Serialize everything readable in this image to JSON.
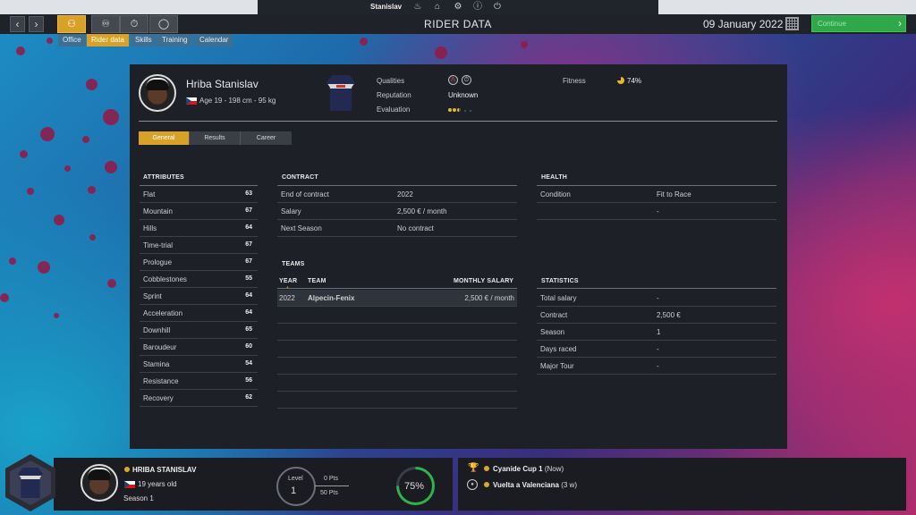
{
  "topbar": {
    "manager_name": "Stanislav"
  },
  "nav": {
    "page_title": "RIDER DATA",
    "date": "09 January 2022",
    "continue_label": "Continue",
    "subtabs": [
      "Office",
      "Rider data",
      "Skills",
      "Training",
      "Calendar"
    ],
    "active_subtab": "Rider data"
  },
  "rider": {
    "name": "Hriba Stanislav",
    "sub": "Age 19 - 198 cm - 95 kg",
    "nationality": "Czech Republic",
    "qualities_label": "Qualities",
    "reputation_label": "Reputation",
    "reputation_value": "Unknown",
    "evaluation_label": "Evaluation",
    "evaluation_stars": 2.5,
    "fitness_label": "Fitness",
    "fitness_value": "74%"
  },
  "profile_tabs": [
    "General",
    "Results",
    "Career"
  ],
  "attributes": {
    "title": "ATTRIBUTES",
    "items": [
      {
        "name": "Flat",
        "value": "63"
      },
      {
        "name": "Mountain",
        "value": "67"
      },
      {
        "name": "Hills",
        "value": "64"
      },
      {
        "name": "Time-trial",
        "value": "67"
      },
      {
        "name": "Prologue",
        "value": "67"
      },
      {
        "name": "Cobblestones",
        "value": "55"
      },
      {
        "name": "Sprint",
        "value": "64"
      },
      {
        "name": "Acceleration",
        "value": "64"
      },
      {
        "name": "Downhill",
        "value": "65"
      },
      {
        "name": "Baroudeur",
        "value": "60"
      },
      {
        "name": "Stamina",
        "value": "54"
      },
      {
        "name": "Resistance",
        "value": "56"
      },
      {
        "name": "Recovery",
        "value": "62"
      }
    ]
  },
  "contract": {
    "title": "CONTRACT",
    "rows": [
      {
        "k": "End of contract",
        "v": "2022"
      },
      {
        "k": "Salary",
        "v": "2,500 € / month"
      },
      {
        "k": "Next Season",
        "v": "No contract"
      }
    ]
  },
  "teams": {
    "title": "TEAMS",
    "headers": {
      "year": "YEAR",
      "team": "TEAM",
      "salary": "MONTHLY SALARY"
    },
    "rows": [
      {
        "year": "2022",
        "team": "Alpecin-Fenix",
        "salary": "2,500 € / month"
      }
    ]
  },
  "health": {
    "title": "HEALTH",
    "rows": [
      {
        "k": "Condition",
        "v": "Fit to Race"
      },
      {
        "k": "",
        "v": "-"
      }
    ]
  },
  "statistics": {
    "title": "STATISTICS",
    "rows": [
      {
        "k": "Total salary",
        "v": "-"
      },
      {
        "k": "Contract",
        "v": "2,500 €"
      },
      {
        "k": "Season",
        "v": "1"
      },
      {
        "k": "Days raced",
        "v": "-"
      },
      {
        "k": "Major Tour",
        "v": "-"
      }
    ]
  },
  "bottom": {
    "name": "HRIBA STANISLAV",
    "age": "19 years old",
    "season": "Season 1",
    "level_label": "Level",
    "level": "1",
    "pts_current": "0 Pts",
    "pts_target": "50 Pts",
    "progress_pct": "75%",
    "progress_value": 0.75,
    "races": [
      {
        "name": "Cyanide Cup 1",
        "when": "(Now)"
      },
      {
        "name": "Vuelta a Valenciana",
        "when": "(3 w)"
      }
    ]
  },
  "colors": {
    "accent": "#d7a227",
    "green": "#2fa84a",
    "panel": "#1d2027",
    "team_green": "#37b64f"
  },
  "icons": [
    "back-arrow-icon",
    "forward-arrow-icon",
    "rider-icon",
    "team-icon",
    "stopwatch-icon",
    "globe-icon",
    "bell-icon",
    "home-icon",
    "settings-icon",
    "info-icon",
    "power-icon",
    "calendar-icon",
    "trophy-icon",
    "race-icon"
  ]
}
